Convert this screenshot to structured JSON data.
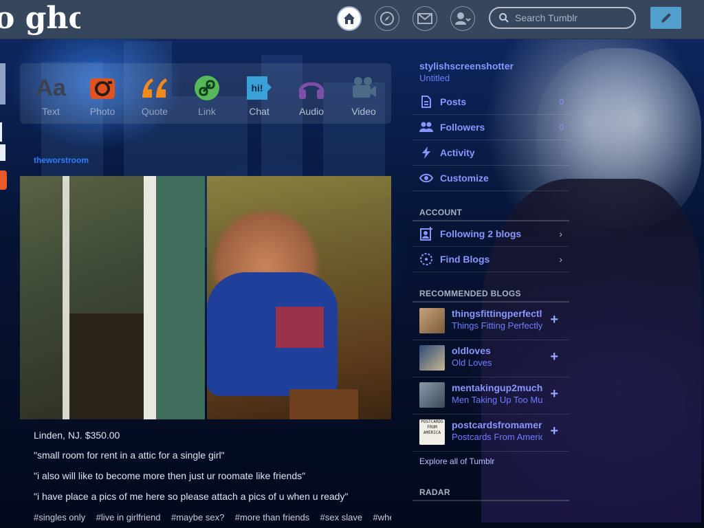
{
  "header": {
    "logo_text": "o ghou",
    "search_placeholder": "Search Tumblr"
  },
  "post_types": [
    {
      "label": "Text",
      "icon": "text-icon"
    },
    {
      "label": "Photo",
      "icon": "camera-icon"
    },
    {
      "label": "Quote",
      "icon": "quote-icon"
    },
    {
      "label": "Link",
      "icon": "link-icon"
    },
    {
      "label": "Chat",
      "icon": "chat-icon"
    },
    {
      "label": "Audio",
      "icon": "headphones-icon"
    },
    {
      "label": "Video",
      "icon": "video-camera-icon"
    }
  ],
  "post": {
    "author": "theworstroom",
    "lines": [
      "Linden, NJ. $350.00",
      "\"small room for rent in a attic for a single girl\"",
      "\"i also will like to become more then just ur roomate like friends\"",
      "\"i have place a pics of me here so please attach a pics of u when u ready\""
    ],
    "tags": [
      "#singles only",
      "#live in girlfriend",
      "#maybe sex?",
      "#more than friends",
      "#sex slave",
      "#whe"
    ]
  },
  "sidebar": {
    "blog_name": "stylishscreenshotter",
    "blog_title": "Untitled",
    "items": [
      {
        "label": "Posts",
        "count": "0",
        "icon": "posts-icon"
      },
      {
        "label": "Followers",
        "count": "0",
        "icon": "followers-icon"
      },
      {
        "label": "Activity",
        "count": "",
        "icon": "lightning-icon"
      },
      {
        "label": "Customize",
        "count": "",
        "icon": "eye-icon"
      }
    ],
    "account_heading": "ACCOUNT",
    "account_items": [
      {
        "label": "Following 2 blogs",
        "icon": "following-icon"
      },
      {
        "label": "Find Blogs",
        "icon": "find-blogs-icon"
      }
    ],
    "recommended_heading": "RECOMMENDED BLOGS",
    "recommended": [
      {
        "name": "thingsfittingperfectly",
        "title": "Things Fitting Perfectly"
      },
      {
        "name": "oldloves",
        "title": "Old Loves"
      },
      {
        "name": "mentakingup2much",
        "title": "Men Taking Up Too Much"
      },
      {
        "name": "postcardsfromamerica",
        "title": "Postcards From America",
        "avatar_text": "POSTCARDS FROM AMERICA"
      }
    ],
    "explore_label": "Explore all of Tumblr",
    "radar_heading": "RADAR"
  },
  "colors": {
    "nav_bg": "#36465d",
    "accent": "#529ecc",
    "sidebar_link": "#8a96ff",
    "author_link": "#2f7cff"
  }
}
